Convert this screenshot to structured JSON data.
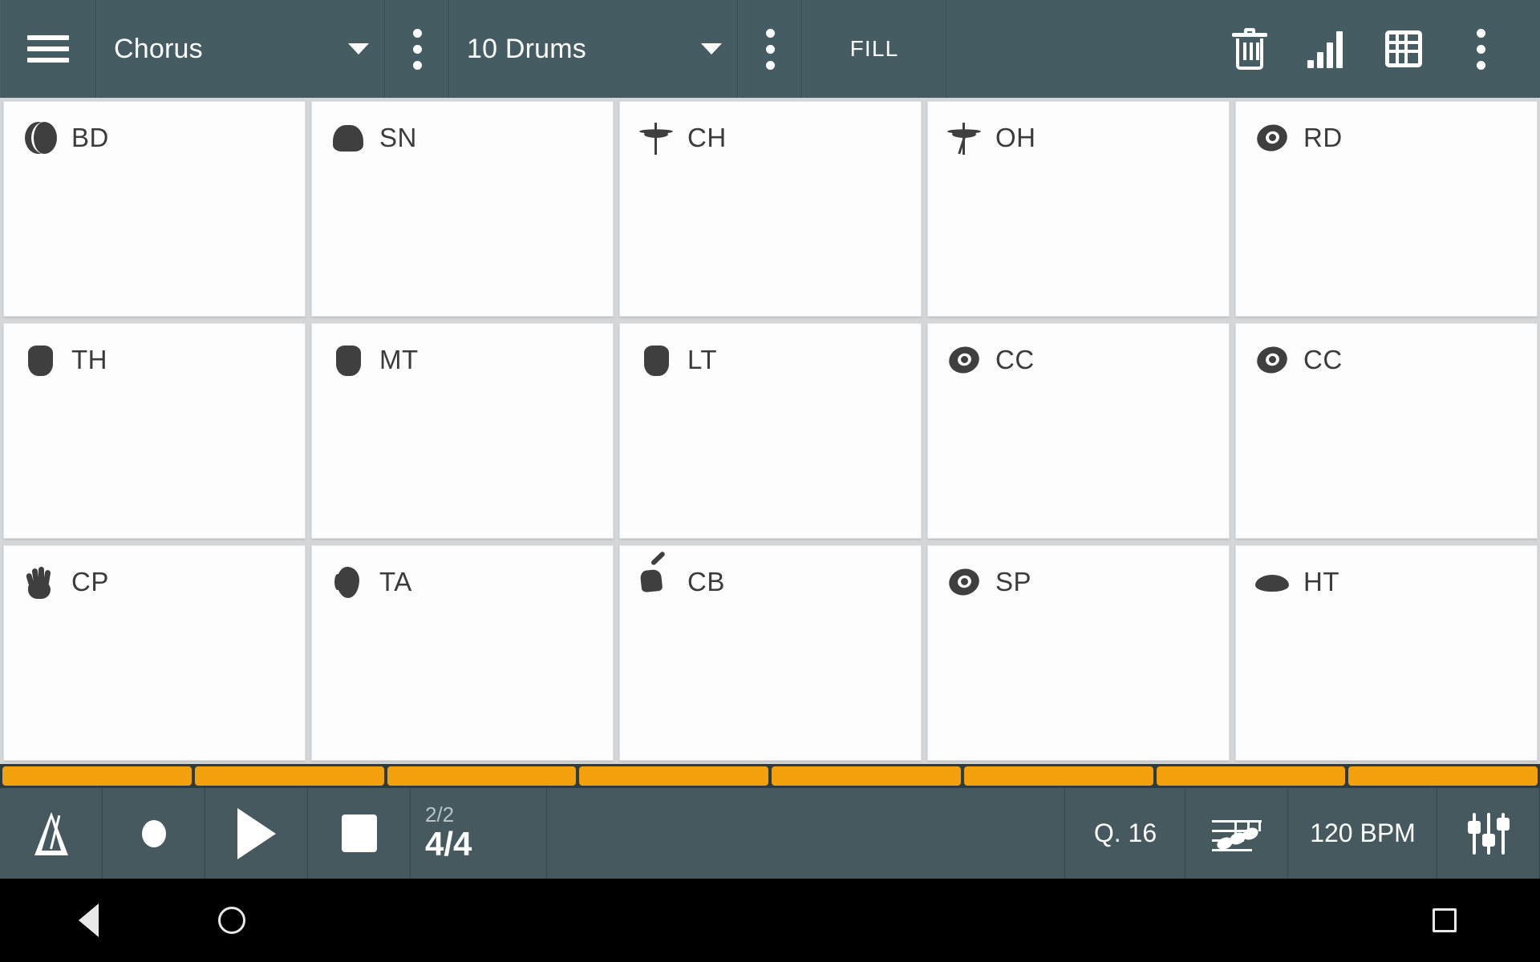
{
  "theme": {
    "toolbar_bg": "#455c63",
    "pad_bg": "#fdfdfd",
    "pad_gap_bg": "#d4d6d8",
    "step_active": "#f2a10c",
    "transport_bg": "#45595f",
    "navbar_bg": "#000000",
    "icon_color": "#ffffff",
    "glyph_color": "#3f3f3f"
  },
  "toolbar": {
    "menu_icon": "hamburger-icon",
    "pattern_spinner": {
      "value": "Chorus",
      "caret_icon": "caret-down-icon"
    },
    "pattern_overflow_icon": "kebab-menu-icon",
    "kit_spinner": {
      "value": "10 Drums",
      "caret_icon": "caret-down-icon"
    },
    "kit_overflow_icon": "kebab-menu-icon",
    "fill_label": "FILL",
    "actions": [
      {
        "name": "delete-button",
        "icon": "trash-icon"
      },
      {
        "name": "velocity-button",
        "icon": "signal-bars-icon"
      },
      {
        "name": "grid-button",
        "icon": "grid-icon"
      },
      {
        "name": "overflow-button",
        "icon": "kebab-menu-icon"
      }
    ]
  },
  "pads": {
    "rows": [
      [
        {
          "label": "BD",
          "icon": "bass-drum-icon",
          "glyph": "bd"
        },
        {
          "label": "SN",
          "icon": "snare-drum-icon",
          "glyph": "snare"
        },
        {
          "label": "CH",
          "icon": "closed-hihat-icon",
          "glyph": "hh-closed"
        },
        {
          "label": "OH",
          "icon": "open-hihat-icon",
          "glyph": "hh-open"
        },
        {
          "label": "RD",
          "icon": "ride-cymbal-icon",
          "glyph": "cymbal"
        }
      ],
      [
        {
          "label": "TH",
          "icon": "high-tom-icon",
          "glyph": "tom"
        },
        {
          "label": "MT",
          "icon": "mid-tom-icon",
          "glyph": "tom"
        },
        {
          "label": "LT",
          "icon": "low-tom-icon",
          "glyph": "tom"
        },
        {
          "label": "CC",
          "icon": "crash-cymbal-icon",
          "glyph": "cymbal"
        },
        {
          "label": "CC",
          "icon": "crash-cymbal-icon",
          "glyph": "cymbal"
        }
      ],
      [
        {
          "label": "CP",
          "icon": "hand-clap-icon",
          "glyph": "hand"
        },
        {
          "label": "TA",
          "icon": "tambourine-icon",
          "glyph": "tamb"
        },
        {
          "label": "CB",
          "icon": "cowbell-icon",
          "glyph": "cowbell"
        },
        {
          "label": "SP",
          "icon": "splash-cymbal-icon",
          "glyph": "cymbal"
        },
        {
          "label": "HT",
          "icon": "hand-drum-icon",
          "glyph": "ht"
        }
      ]
    ]
  },
  "stepbar": {
    "segment_count": 8,
    "segments": [
      {
        "active": true
      },
      {
        "active": true
      },
      {
        "active": true
      },
      {
        "active": true
      },
      {
        "active": true
      },
      {
        "active": true
      },
      {
        "active": true
      },
      {
        "active": true
      }
    ]
  },
  "transport": {
    "metronome_icon": "metronome-icon",
    "record_icon": "record-icon",
    "play_icon": "play-icon",
    "stop_icon": "stop-icon",
    "bar_position": "2/2",
    "time_signature": "4/4",
    "quantize": "Q. 16",
    "notes_icon": "music-notes-icon",
    "tempo": "120 BPM",
    "mixer_icon": "mixer-sliders-icon"
  },
  "navbar": {
    "back_icon": "back-triangle-icon",
    "home_icon": "home-circle-icon",
    "recents_icon": "recents-square-icon"
  }
}
